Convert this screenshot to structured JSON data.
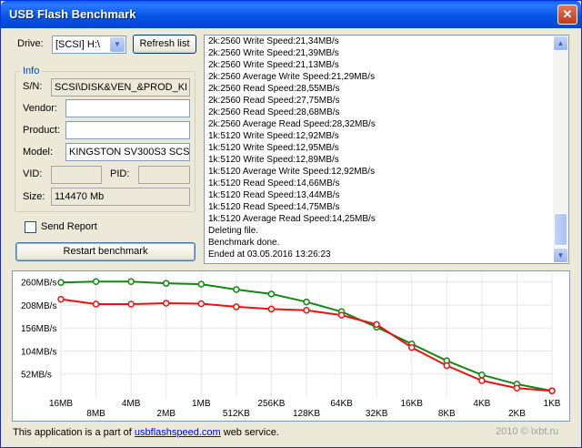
{
  "window": {
    "title": "USB Flash Benchmark"
  },
  "drive": {
    "label": "Drive:",
    "value": "[SCSI] H:\\",
    "refresh_label": "Refresh list"
  },
  "info": {
    "group_title": "Info",
    "sn_label": "S/N:",
    "sn_value": "SCSI\\DISK&VEN_&PROD_KI",
    "vendor_label": "Vendor:",
    "vendor_value": "",
    "product_label": "Product:",
    "product_value": "",
    "model_label": "Model:",
    "model_value": "KINGSTON SV300S3 SCS",
    "vid_label": "VID:",
    "vid_value": "",
    "pid_label": "PID:",
    "pid_value": "",
    "size_label": "Size:",
    "size_value": "114470 Mb"
  },
  "send_report_label": "Send Report",
  "restart_label": "Restart benchmark",
  "log_lines": [
    "2k:2560 Write Speed:21,34MB/s",
    "2k:2560 Write Speed:21,39MB/s",
    "2k:2560 Write Speed:21,13MB/s",
    "2k:2560 Average Write Speed:21,29MB/s",
    "2k:2560 Read Speed:28,55MB/s",
    "2k:2560 Read Speed:27,75MB/s",
    "2k:2560 Read Speed:28,68MB/s",
    "2k:2560 Average Read Speed:28,32MB/s",
    "1k:5120 Write Speed:12,92MB/s",
    "1k:5120 Write Speed:12,95MB/s",
    "1k:5120 Write Speed:12,89MB/s",
    "1k:5120 Average Write Speed:12,92MB/s",
    "1k:5120 Read Speed:14,66MB/s",
    "1k:5120 Read Speed:13,44MB/s",
    "1k:5120 Read Speed:14,75MB/s",
    "1k:5120 Average Read Speed:14,25MB/s",
    "Deleting file.",
    "Benchmark done.",
    "Ended at 03.05.2016 13:26:23"
  ],
  "chart_data": {
    "type": "line",
    "categories": [
      "16MB",
      "8MB",
      "4MB",
      "2MB",
      "1MB",
      "512KB",
      "256KB",
      "128KB",
      "64KB",
      "32KB",
      "16KB",
      "8KB",
      "4KB",
      "2KB",
      "1KB"
    ],
    "y_tick_labels": [
      "260MB/s",
      "208MB/s",
      "156MB/s",
      "104MB/s",
      "52MB/s"
    ],
    "y_tick_values": [
      260,
      208,
      156,
      104,
      52
    ],
    "ylim": [
      0,
      280
    ],
    "series": [
      {
        "color": "#118811",
        "values": [
          259,
          261,
          261,
          257,
          255,
          243,
          233,
          215,
          193,
          158,
          120,
          82,
          50,
          29,
          14
        ]
      },
      {
        "color": "#ee1111",
        "values": [
          221,
          210,
          210,
          212,
          211,
          204,
          199,
          196,
          185,
          164,
          112,
          71,
          37,
          20,
          14
        ]
      }
    ]
  },
  "footer": {
    "text_before": "This application is a part of ",
    "link": "usbflashspeed.com",
    "text_after": " web service."
  },
  "watermark": "2010 © Ixbt.ru"
}
